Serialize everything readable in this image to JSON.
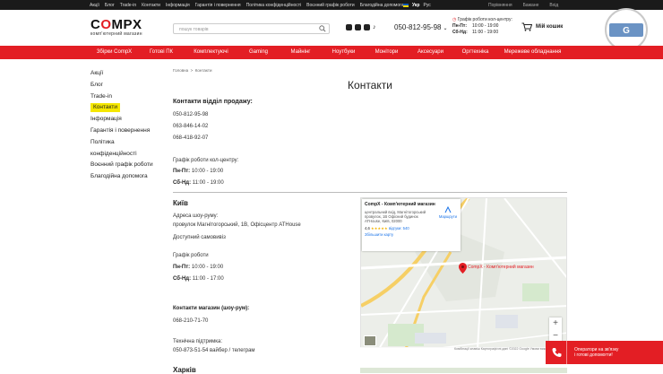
{
  "topbar": {
    "links": [
      "Акції",
      "Блог",
      "Trade-in",
      "Контакти",
      "Інформація",
      "Гарантія і повернення",
      "Політика конфіденційності",
      "Воєнний графік роботи",
      "Благодійна допомога"
    ],
    "lang_active": "Укр",
    "lang_other": "Рус",
    "compare": "Порівняння",
    "wishlist": "Бажане",
    "login": "Вхід"
  },
  "header": {
    "brand_left": "C",
    "brand_o": "O",
    "brand_right": "MPX",
    "tagline": "комп'ютерний магазин",
    "search_placeholder": "пошук товарів",
    "phone": "050-812-95-98",
    "hours_title": "Графік роботи кол-центру:",
    "hours_weekday_label": "Пн-Пт:",
    "hours_weekday": "10:00 - 19:00",
    "hours_weekend_label": "Сб-Нд:",
    "hours_weekend": "11:00 - 19:00",
    "cart_label": "Мій кошик"
  },
  "nav": {
    "items": [
      "Збірки CompX",
      "Готові ПК",
      "Комплектуючі",
      "Gaming",
      "Майнінг",
      "Ноутбуки",
      "Монітори",
      "Аксесуари",
      "Оргтехніка",
      "Мережеве обладнання"
    ]
  },
  "sidebar": {
    "items": [
      "Акції",
      "Блог",
      "Trade-in",
      "Контакти",
      "Інформація",
      "Гарантія і повернення",
      "Політика конфіденційності",
      "Воєнний графік роботи",
      "Благодійна допомога"
    ],
    "active": "Контакти"
  },
  "breadcrumb": {
    "home": "Головна",
    "sep": ">",
    "current": "Контакти"
  },
  "page": {
    "title": "Контакти",
    "sales_heading": "Контакти відділ продажу:",
    "sales_phones": [
      "050-812-95-98",
      "063-846-14-02",
      "068-418-92-07"
    ],
    "callcenter_title": "Графік роботи кол-центру:",
    "callcenter_weekday_label": "Пн-Пт:",
    "callcenter_weekday": "10:00 - 19:00",
    "callcenter_weekend_label": "Сб-Нд:",
    "callcenter_weekend": "11:00 - 19:00"
  },
  "kyiv": {
    "city": "Київ",
    "address_label": "Адреса шоу-руму:",
    "address": "провулок Магнітогорський, 1В, Офісцентр ATHouse",
    "pickup": "Доступний самовивіз",
    "schedule_label": "Графік роботи",
    "weekday_label": "Пн-Пт:",
    "weekday": "10:00 - 19:00",
    "weekend_label": "Сб-Нд:",
    "weekend": "11:00 - 17:00",
    "showroom_contacts": "Контакти магазин (шоу-рум):",
    "showroom_phone": "068-210-71-70",
    "support_label": "Технічна підтримка:",
    "support_phone": "050-873-51-54  вайбер / телеграм"
  },
  "map": {
    "card_title": "CompX - Комп'ютерний магазин",
    "card_address": "центральний вхід, Магнітогорський провулок, 1В Офісний будинок ATHouse, Київ, 02000",
    "rating": "4,6",
    "stars": "★★★★★",
    "reviews": "відгуки: 540",
    "larger_map": "Збільшити карту",
    "route": "Маршрути",
    "pin_label": "CompX - Комп'ютерний магазин",
    "zoom_in": "+",
    "zoom_out": "−",
    "footer": "Комбінації клавіш   Картографічні дані ©2022 Google   Умови використання"
  },
  "operator": {
    "text_line1": "Оператори на зв'язку",
    "text_line2": "і готові допомогти!"
  },
  "kharkiv": {
    "city": "Харків"
  },
  "colors": {
    "brand_red": "#e31e24",
    "active_yellow": "#f5e700",
    "topbar_dark": "#1a1a1a"
  }
}
